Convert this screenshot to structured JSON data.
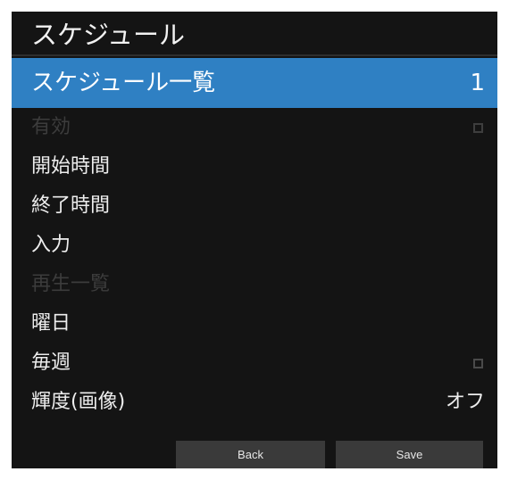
{
  "header": {
    "title": "スケジュール"
  },
  "menu": {
    "schedule_list": {
      "label": "スケジュール一覧",
      "value": "1"
    },
    "enabled": {
      "label": "有効",
      "checkbox": "unchecked"
    },
    "start_time": {
      "label": "開始時間"
    },
    "end_time": {
      "label": "終了時間"
    },
    "input": {
      "label": "入力"
    },
    "playlist": {
      "label": "再生一覧"
    },
    "weekday": {
      "label": "曜日"
    },
    "weekly": {
      "label": "毎週",
      "checkbox": "unchecked"
    },
    "brightness": {
      "label": "輝度(画像)",
      "value": "オフ"
    }
  },
  "buttons": {
    "back_label": "Back",
    "save_label": "Save"
  },
  "colors": {
    "panel_background": "#141414",
    "selected_highlight": "#2f80c3",
    "text": "#ededed",
    "disabled_text": "#3c3c3c",
    "button_background": "#3a3a3a"
  }
}
